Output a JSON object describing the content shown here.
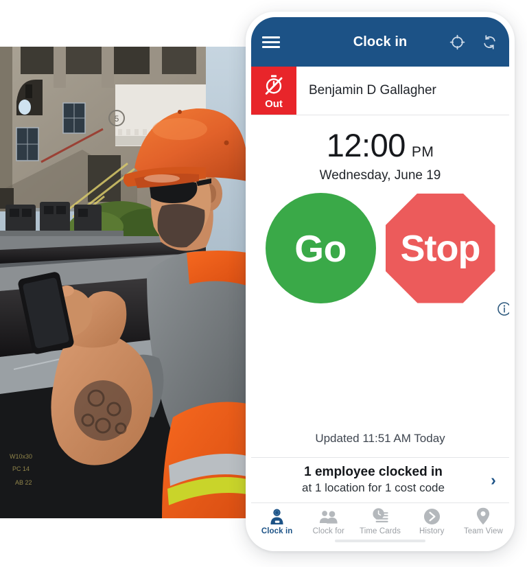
{
  "photo": {
    "alt": "construction-worker-with-orange-hard-hat-using-phone",
    "description": "Construction worker in orange hard hat, sunglasses and orange hi-vis vest looking at a black smartphone on a jobsite with steel beams and a concrete building",
    "colors": {
      "hardhat": "#e2622a",
      "vest": "#f15a1c",
      "vest_stripe": "#c9d42a",
      "shirt": "#787d80",
      "skin": "#c98a61",
      "sky": "#b9c9d6",
      "concrete": "#9b9385",
      "steel": "#1d1c1e"
    }
  },
  "appbar": {
    "title": "Clock in",
    "menu_icon": "hamburger-icon",
    "gps_icon": "gps-crosshair-icon",
    "sync_icon": "sync-refresh-icon",
    "bg_color": "#1c5286"
  },
  "employee": {
    "status_badge": "Out",
    "status_icon": "stopwatch-off-icon",
    "status_color": "#e8252a",
    "name": "Benjamin D Gallagher"
  },
  "clock": {
    "time": "12:00",
    "meridiem": "PM",
    "date": "Wednesday, June 19",
    "go_label": "Go",
    "stop_label": "Stop",
    "go_color": "#3aa948",
    "stop_color": "#ec5b5b",
    "info_icon": "info-circle-icon",
    "updated": "Updated 11:51 AM Today"
  },
  "banner": {
    "main": "1 employee clocked in",
    "sub": "at 1 location for 1 cost code",
    "chevron": "›",
    "chevron_icon": "chevron-right-icon"
  },
  "tabs": [
    {
      "label": "Clock in",
      "icon": "person-clock-in-icon",
      "active": true
    },
    {
      "label": "Clock for",
      "icon": "people-group-icon",
      "active": false
    },
    {
      "label": "Time Cards",
      "icon": "clock-document-icon",
      "active": false
    },
    {
      "label": "History",
      "icon": "history-arrow-icon",
      "active": false
    },
    {
      "label": "Team View",
      "icon": "map-pin-icon",
      "active": false
    }
  ],
  "theme": {
    "accent": "#1c5286",
    "inactive_tab": "#9b9fa4",
    "divider": "#e3e5e7"
  }
}
